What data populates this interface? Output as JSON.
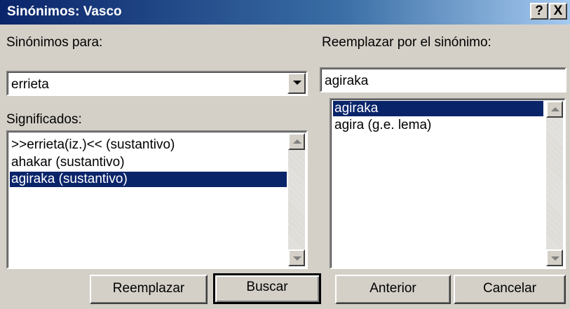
{
  "window": {
    "title": "Sinónimos: Vasco",
    "help_label": "?",
    "close_label": "X"
  },
  "left": {
    "synonyms_for_label": "Sinónimos para:",
    "synonyms_for_value": "errieta",
    "meanings_label": "Significados:",
    "meanings": [
      {
        "text": ">>errieta(iz.)<< (sustantivo)",
        "selected": false
      },
      {
        "text": "ahakar (sustantivo)",
        "selected": false
      },
      {
        "text": "agiraka (sustantivo)",
        "selected": true
      }
    ]
  },
  "right": {
    "replace_label": "Reemplazar por el sinónimo:",
    "replace_value": "agiraka",
    "synonyms": [
      {
        "text": "agiraka",
        "selected": true
      },
      {
        "text": "agira (g.e. lema)",
        "selected": false
      }
    ]
  },
  "buttons": {
    "replace": "Reemplazar",
    "search": "Buscar",
    "previous": "Anterior",
    "cancel": "Cancelar"
  },
  "colors": {
    "title_bar": "#0a246a",
    "selection": "#0a246a",
    "dialog_face": "#d4d0c8"
  }
}
